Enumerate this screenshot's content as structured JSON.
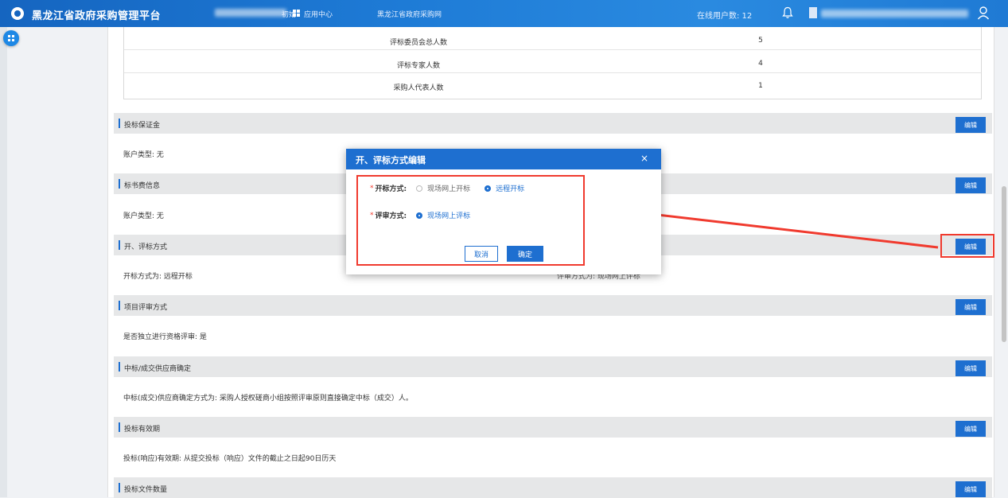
{
  "topbar": {
    "app_title": "黑龙江省政府采购管理平台",
    "nav_partial": "初始",
    "app_center": "应用中心",
    "procurement_site": "黑龙江省政府采购网",
    "online_users": "在线用户数: 12"
  },
  "committee_table": [
    {
      "label": "评标委员会总人数",
      "value": "5"
    },
    {
      "label": "评标专家人数",
      "value": "4"
    },
    {
      "label": "采购人代表人数",
      "value": "1"
    }
  ],
  "edit_label": "编辑",
  "sections": {
    "bid_bond": {
      "title": "投标保证金",
      "body": "账户类型: 无"
    },
    "tender_fee": {
      "title": "标书费信息",
      "body": "账户类型: 无"
    },
    "open_eval": {
      "title": "开、评标方式",
      "body": "开标方式为: 远程开标",
      "body_right": "评审方式为: 现场网上评标"
    },
    "project_review": {
      "title": "项目评审方式",
      "body": "是否独立进行资格评审: 是"
    },
    "winner_confirm": {
      "title": "中标/成交供应商确定",
      "body": "中标(成交)供应商确定方式为: 采购人授权磋商小组按照评审原则直接确定中标（成交）人。"
    },
    "bid_validity": {
      "title": "投标有效期",
      "body": "投标(响应)有效期: 从提交投标（响应）文件的截止之日起90日历天"
    },
    "bid_docs": {
      "title": "投标文件数量"
    }
  },
  "modal": {
    "title": "开、评标方式编辑",
    "close_glyph": "×",
    "opening_label": "开标方式:",
    "opening_options": [
      {
        "label": "现场网上开标",
        "selected": false
      },
      {
        "label": "远程开标",
        "selected": true
      }
    ],
    "review_label": "评审方式:",
    "review_options": [
      {
        "label": "现场网上评标",
        "selected": true
      }
    ],
    "required_mark": "*",
    "cancel_label": "取消",
    "ok_label": "确定"
  },
  "colors": {
    "primary": "#1e6fd0",
    "annotation_red": "#f03a2e",
    "topbar": "#1565c0"
  }
}
